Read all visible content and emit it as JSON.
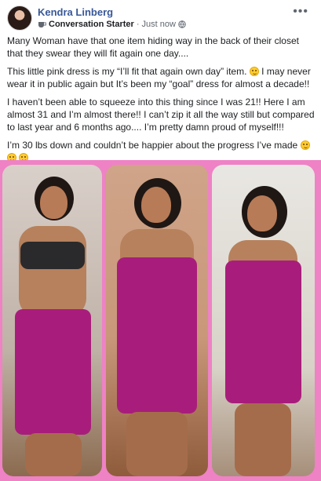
{
  "post": {
    "author": "Kendra Linberg",
    "badge_label": "Conversation Starter",
    "separator": "·",
    "timestamp": "Just now",
    "icons": {
      "badge": "coffee-cup-icon",
      "privacy": "globe-icon",
      "more": "more-options-icon"
    },
    "more_label": "•••"
  },
  "content": {
    "paragraph_1": "Many Woman have that one item hiding way in the back of their closet that they swear they will fit again one day....",
    "paragraph_2_a": "This little pink dress is my “I’ll fit that again own day” item.",
    "paragraph_2_b": "I may never wear it in public again but It’s been my “goal” dress for almost a decade!!",
    "paragraph_3": "I haven’t been able to squeeze into this thing since I was 21!! Here I am almost 31 and I’m almost there!! I can’t zip it all the way still but compared to last year and 6 months ago.... I’m pretty damn proud of myself!!!",
    "paragraph_4": "I’m 30 lbs down and couldn’t be happier about the progress I’ve made"
  },
  "colors": {
    "author_link": "#385898",
    "photo_frame": "#ee82c4",
    "dress": "#a81d7b"
  },
  "photos": [
    {
      "name": "progress-photo-1"
    },
    {
      "name": "progress-photo-2"
    },
    {
      "name": "progress-photo-3"
    }
  ]
}
